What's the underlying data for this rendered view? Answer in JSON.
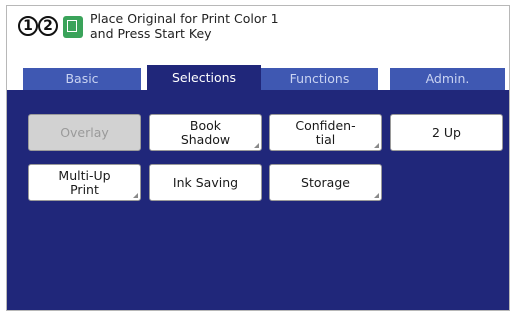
{
  "header": {
    "drum1": "1",
    "drum2": "2",
    "mode_icon": "master-making-icon",
    "message_line1": "Place Original for Print Color 1",
    "message_line2": "and Press Start Key"
  },
  "tabs": [
    {
      "label": "Basic",
      "active": false
    },
    {
      "label": "Selections",
      "active": true
    },
    {
      "label": "Functions",
      "active": false
    },
    {
      "label": "Admin.",
      "active": false
    }
  ],
  "buttons": [
    {
      "label": "Overlay",
      "enabled": false
    },
    {
      "label": "Book\nShadow",
      "enabled": true
    },
    {
      "label": "Confiden-\ntial",
      "enabled": true
    },
    {
      "label": "2 Up",
      "enabled": true
    },
    {
      "label": "Multi-Up\nPrint",
      "enabled": true
    },
    {
      "label": "Ink Saving",
      "enabled": true
    },
    {
      "label": "Storage",
      "enabled": true
    }
  ],
  "colors": {
    "panel": "#20277a",
    "tab": "#3f58b2",
    "active_tab": "#20277a",
    "mode_icon": "#3aa35a"
  }
}
